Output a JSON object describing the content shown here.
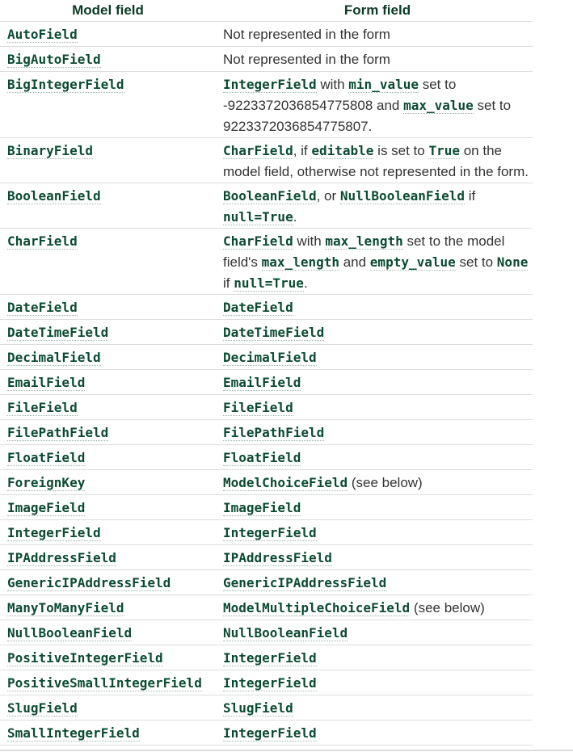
{
  "headers": [
    "Model field",
    "Form field"
  ],
  "rows": [
    {
      "model": "AutoField",
      "form": [
        {
          "t": "Not represented in the form"
        }
      ]
    },
    {
      "model": "BigAutoField",
      "form": [
        {
          "t": "Not represented in the form"
        }
      ]
    },
    {
      "model": "BigIntegerField",
      "form": [
        {
          "c": "IntegerField"
        },
        {
          "t": " with "
        },
        {
          "c": "min_value"
        },
        {
          "t": " set to -9223372036854775808 and "
        },
        {
          "c": "max_value"
        },
        {
          "t": " set to 9223372036854775807."
        }
      ]
    },
    {
      "model": "BinaryField",
      "form": [
        {
          "c": "CharField"
        },
        {
          "t": ", if "
        },
        {
          "c": "editable"
        },
        {
          "t": " is set to "
        },
        {
          "c": "True"
        },
        {
          "t": " on the model field, otherwise not represented in the form."
        }
      ]
    },
    {
      "model": "BooleanField",
      "form": [
        {
          "c": "BooleanField"
        },
        {
          "t": ", or "
        },
        {
          "c": "NullBooleanField"
        },
        {
          "t": " if "
        },
        {
          "c": "null=True"
        },
        {
          "t": "."
        }
      ]
    },
    {
      "model": "CharField",
      "form": [
        {
          "c": "CharField"
        },
        {
          "t": " with "
        },
        {
          "c": "max_length"
        },
        {
          "t": " set to the model field's "
        },
        {
          "c": "max_length"
        },
        {
          "t": " and "
        },
        {
          "c": "empty_value"
        },
        {
          "t": " set to "
        },
        {
          "c": "None"
        },
        {
          "t": " if "
        },
        {
          "c": "null=True"
        },
        {
          "t": "."
        }
      ]
    },
    {
      "model": "DateField",
      "form": [
        {
          "c": "DateField"
        }
      ]
    },
    {
      "model": "DateTimeField",
      "form": [
        {
          "c": "DateTimeField"
        }
      ]
    },
    {
      "model": "DecimalField",
      "form": [
        {
          "c": "DecimalField"
        }
      ]
    },
    {
      "model": "EmailField",
      "form": [
        {
          "c": "EmailField"
        }
      ]
    },
    {
      "model": "FileField",
      "form": [
        {
          "c": "FileField"
        }
      ]
    },
    {
      "model": "FilePathField",
      "form": [
        {
          "c": "FilePathField"
        }
      ]
    },
    {
      "model": "FloatField",
      "form": [
        {
          "c": "FloatField"
        }
      ]
    },
    {
      "model": "ForeignKey",
      "form": [
        {
          "c": "ModelChoiceField"
        },
        {
          "t": " (see below)"
        }
      ]
    },
    {
      "model": "ImageField",
      "form": [
        {
          "c": "ImageField"
        }
      ]
    },
    {
      "model": "IntegerField",
      "form": [
        {
          "c": "IntegerField"
        }
      ]
    },
    {
      "model": "IPAddressField",
      "form": [
        {
          "c": "IPAddressField"
        }
      ]
    },
    {
      "model": "GenericIPAddressField",
      "form": [
        {
          "c": "GenericIPAddressField"
        }
      ]
    },
    {
      "model": "ManyToManyField",
      "form": [
        {
          "c": "ModelMultipleChoiceField"
        },
        {
          "t": " (see below)"
        }
      ]
    },
    {
      "model": "NullBooleanField",
      "form": [
        {
          "c": "NullBooleanField"
        }
      ]
    },
    {
      "model": "PositiveIntegerField",
      "form": [
        {
          "c": "IntegerField"
        }
      ]
    },
    {
      "model": "PositiveSmallIntegerField",
      "form": [
        {
          "c": "IntegerField"
        }
      ]
    },
    {
      "model": "SlugField",
      "form": [
        {
          "c": "SlugField"
        }
      ]
    },
    {
      "model": "SmallIntegerField",
      "form": [
        {
          "c": "IntegerField"
        }
      ]
    }
  ]
}
